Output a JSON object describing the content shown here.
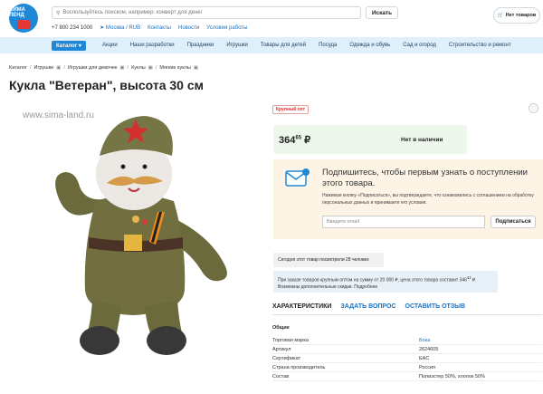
{
  "header": {
    "logo_text": "СИМА ЛЕНД",
    "search_placeholder": "Воспользуйтесь поиском, например: конверт для денег",
    "search_button": "Искать",
    "cart_label": "Нет товаров",
    "phone": "+7 800 234 1000",
    "region": "Москва / RUB",
    "links": [
      "Контакты",
      "Новости",
      "Условия работы"
    ]
  },
  "nav": {
    "catalog": "Каталог",
    "items": [
      "Акции",
      "Наши разработки",
      "Праздники",
      "Игрушки",
      "Товары для детей",
      "Посуда",
      "Одежда и обувь",
      "Сад и огород",
      "Строительство и ремонт"
    ]
  },
  "breadcrumbs": [
    "Каталог",
    "Игрушки",
    "Игрушки для девочек",
    "Куклы",
    "Мягкие куклы"
  ],
  "product": {
    "title": "Кукла \"Ветеран\", высота 30 см",
    "watermark": "www.sima-land.ru",
    "badge": "Крупный опт",
    "price_main": "364",
    "price_cents": "65",
    "currency": "₽",
    "stock": "Нет в наличии"
  },
  "subscribe": {
    "title": "Подпишитесь, чтобы первым узнать о поступлении этого товара.",
    "text": "Нажимая кнопку «Подписаться», вы подтверждаете, что ознакомились с соглашением на обработку персональных данных и принимаете его условия.",
    "email_placeholder": "Введите email",
    "button": "Подписаться"
  },
  "views_text": "Сегодня этот товар посмотрели 28 человек",
  "wholesale": {
    "text": "При заказе товаров крупным оптом на сумму от 20 000 ₽, цена этого товара составит 346",
    "price_cents": "42",
    "price_suffix": "₽.",
    "more": "Возможны дополнительные скидки. Подробнее"
  },
  "tabs": [
    "ХАРАКТЕРИСТИКИ",
    "ЗАДАТЬ ВОПРОС",
    "ОСТАВИТЬ ОТЗЫВ"
  ],
  "specs": {
    "heading": "Общие",
    "rows": [
      {
        "key": "Торговая марка",
        "value": "Бока"
      },
      {
        "key": "Артикул",
        "value": "2624605"
      },
      {
        "key": "Сертификат",
        "value": "EAC"
      },
      {
        "key": "Страна производитель",
        "value": "Россия"
      },
      {
        "key": "Состав",
        "value": "Полиэстер 50%, хлопок 50%"
      }
    ]
  },
  "colors": {
    "accent": "#1e88d6",
    "nav_bg": "#dff0fa",
    "price_bg": "#eef7ec",
    "subscribe_bg": "#fdf4e6"
  }
}
